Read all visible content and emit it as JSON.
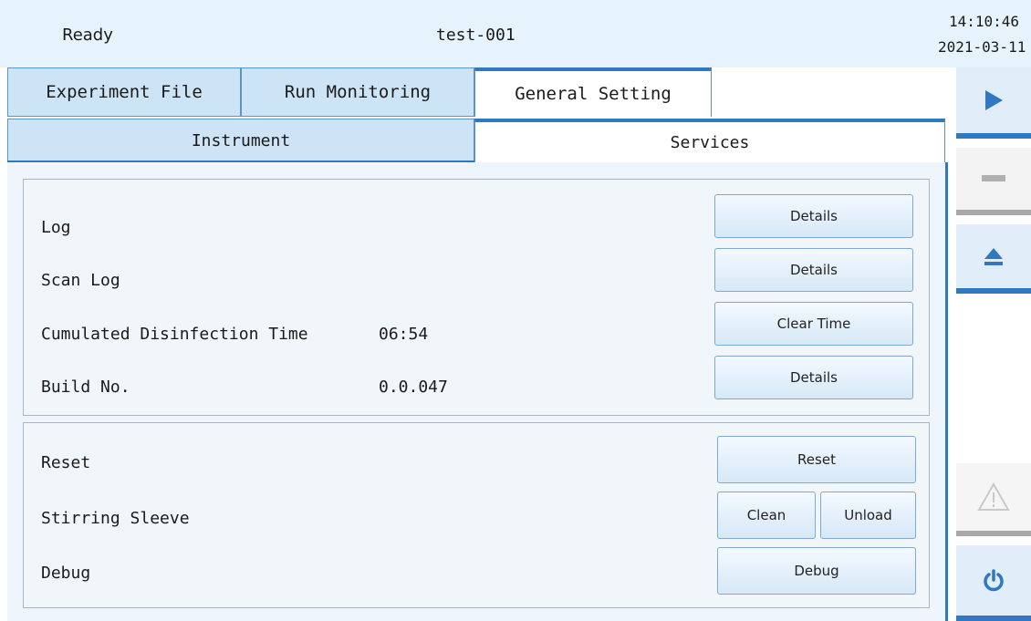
{
  "status": {
    "state": "Ready",
    "experiment": "test-001",
    "time": "14:10:46",
    "date": "2021-03-11"
  },
  "tabs": [
    {
      "label": "Experiment File",
      "active": false
    },
    {
      "label": "Run Monitoring",
      "active": false
    },
    {
      "label": "General Setting",
      "active": true
    }
  ],
  "subtabs": [
    {
      "label": "Instrument",
      "active": false
    },
    {
      "label": "Services",
      "active": true
    }
  ],
  "panel1": {
    "rows": [
      {
        "label": "Log",
        "value": "",
        "button": "Details"
      },
      {
        "label": "Scan Log",
        "value": "",
        "button": "Details"
      },
      {
        "label": "Cumulated Disinfection Time",
        "value": "06:54",
        "button": "Clear Time"
      },
      {
        "label": "Build No.",
        "value": "0.0.047",
        "button": "Details"
      }
    ]
  },
  "panel2": {
    "reset_label": "Reset",
    "reset_button": "Reset",
    "sleeve_label": "Stirring Sleeve",
    "clean_button": "Clean",
    "unload_button": "Unload",
    "debug_label": "Debug",
    "debug_button": "Debug"
  },
  "sidebar": {
    "icons": [
      "play-icon",
      "stop-icon",
      "eject-icon",
      "warning-icon",
      "power-icon"
    ],
    "accent": "#2f78c4",
    "disabled": "#a9a9a9"
  }
}
